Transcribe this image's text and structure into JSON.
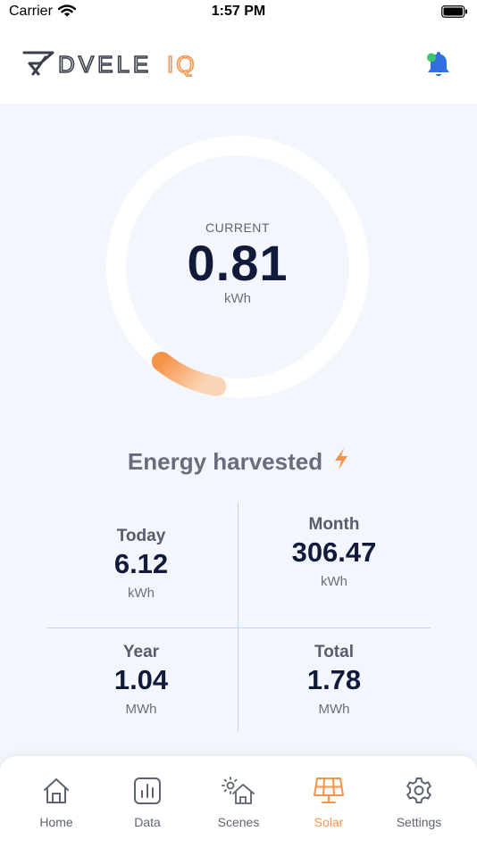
{
  "status_bar": {
    "carrier": "Carrier",
    "time": "1:57 PM"
  },
  "header": {
    "logo_icon": "dvele-logo-icon",
    "logo_text": "DVELE",
    "logo_suffix": "IQ"
  },
  "gauge": {
    "caption": "CURRENT",
    "value": "0.81",
    "unit": "kWh",
    "fill_fraction": 0.08,
    "accent": "#f7944a"
  },
  "energy": {
    "title": "Energy harvested",
    "stats": {
      "today": {
        "label": "Today",
        "value": "6.12",
        "unit": "kWh"
      },
      "month": {
        "label": "Month",
        "value": "306.47",
        "unit": "kWh"
      },
      "year": {
        "label": "Year",
        "value": "1.04",
        "unit": "MWh"
      },
      "total": {
        "label": "Total",
        "value": "1.78",
        "unit": "MWh"
      }
    }
  },
  "tabs": [
    {
      "label": "Home",
      "icon": "home-icon"
    },
    {
      "label": "Data",
      "icon": "chart-icon"
    },
    {
      "label": "Scenes",
      "icon": "scenes-icon"
    },
    {
      "label": "Solar",
      "icon": "solar-panel-icon",
      "active": true
    },
    {
      "label": "Settings",
      "icon": "gear-icon"
    }
  ],
  "colors": {
    "accent": "#f7944a",
    "primary_text": "#111a3b",
    "background": "#f3f6fc",
    "bell": "#2f6fe0",
    "notification_dot": "#3ec46d"
  }
}
